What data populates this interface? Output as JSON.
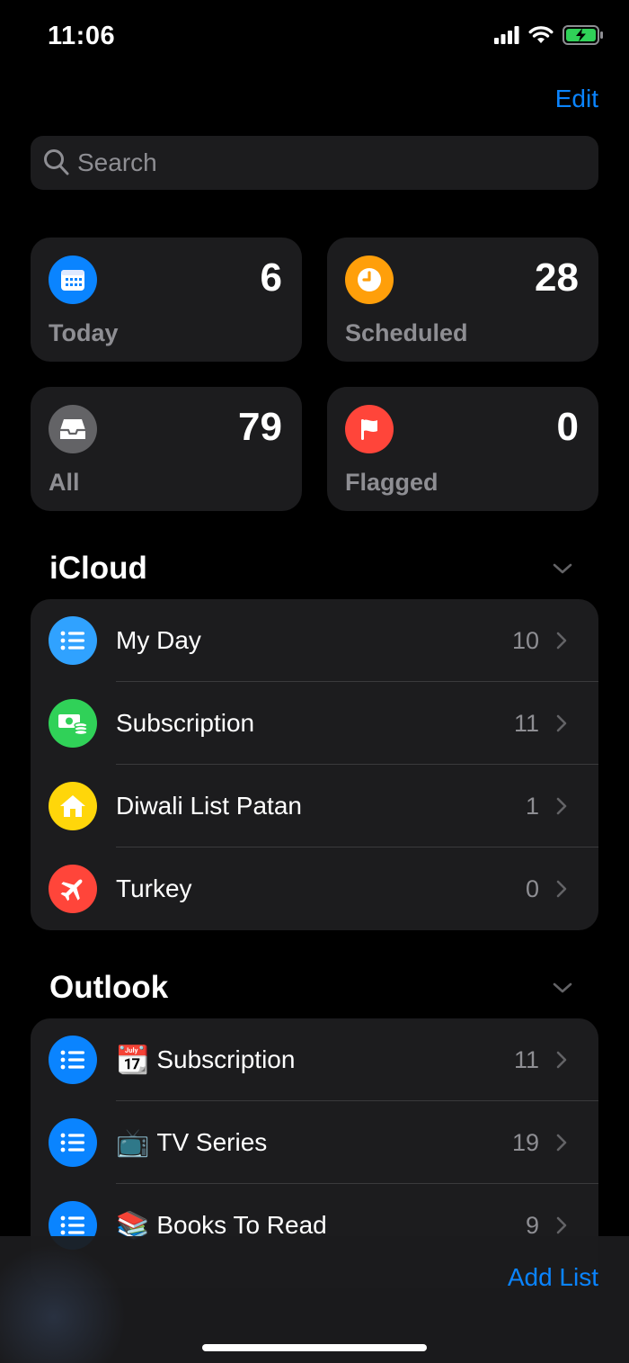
{
  "status": {
    "time": "11:06"
  },
  "header": {
    "edit_label": "Edit"
  },
  "search": {
    "placeholder": "Search"
  },
  "smart_lists": [
    {
      "label": "Today",
      "count": "6",
      "icon": "calendar-icon",
      "color": "#0a84ff"
    },
    {
      "label": "Scheduled",
      "count": "28",
      "icon": "clock-icon",
      "color": "#ff9f0a"
    },
    {
      "label": "All",
      "count": "79",
      "icon": "tray-icon",
      "color": "#636366"
    },
    {
      "label": "Flagged",
      "count": "0",
      "icon": "flag-icon",
      "color": "#ff453a"
    }
  ],
  "sections": [
    {
      "title": "iCloud",
      "lists": [
        {
          "name": "My Day",
          "count": "10",
          "icon": "list-icon",
          "color": "#30a2ff"
        },
        {
          "name": "Subscription",
          "count": "11",
          "icon": "money-icon",
          "color": "#30d158"
        },
        {
          "name": "Diwali List Patan",
          "count": "1",
          "icon": "house-icon",
          "color": "#ffd60a"
        },
        {
          "name": "Turkey",
          "count": "0",
          "icon": "airplane-icon",
          "color": "#ff453a"
        }
      ]
    },
    {
      "title": "Outlook",
      "lists": [
        {
          "emoji": "📆",
          "name": "Subscription",
          "count": "11",
          "icon": "list-icon",
          "color": "#0a84ff"
        },
        {
          "emoji": "📺",
          "name": "TV Series",
          "count": "19",
          "icon": "list-icon",
          "color": "#0a84ff"
        },
        {
          "emoji": "📚",
          "name": "Books To Read",
          "count": "9",
          "icon": "list-icon",
          "color": "#0a84ff"
        }
      ]
    }
  ],
  "footer": {
    "add_list_label": "Add List"
  }
}
